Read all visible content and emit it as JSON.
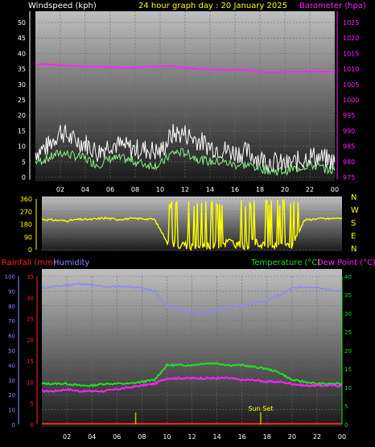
{
  "header": {
    "left_title": "Windspeed (kph)",
    "center_title": "24 hour graph day : 20 January 2025",
    "right_title": "Barometer (hpa)"
  },
  "bottom_header": {
    "rainfall": "Rainfall (mm)",
    "humidity": "Humidity",
    "temperature": "Temperature (°C)",
    "dewpoint": "Dew Point (°C)"
  },
  "annotation": {
    "sunset": "Sun Set"
  },
  "colors": {
    "wind": "#ffffff",
    "wind_avg": "#88ee88",
    "barometer": "#ff22ff",
    "direction": "#ffff00",
    "humidity": "#8888ff",
    "rain": "#ff2222",
    "temperature": "#22dd22",
    "dewpoint": "#ff22ff",
    "event": "#bbbb00"
  },
  "chart_data": [
    {
      "type": "line",
      "xlabel_ticks": [
        "02",
        "04",
        "06",
        "08",
        "10",
        "12",
        "14",
        "16",
        "18",
        "20",
        "22",
        "00"
      ],
      "left_axis": {
        "label": "Windspeed (kph)",
        "ylim": [
          0,
          50
        ],
        "ticks": [
          "0",
          "5",
          "10",
          "15",
          "20",
          "25",
          "30",
          "35",
          "40",
          "45",
          "50"
        ]
      },
      "right_axis": {
        "label": "Barometer (hpa)",
        "ylim": [
          975,
          1025
        ],
        "ticks": [
          "975",
          "980",
          "985",
          "990",
          "995",
          "1000",
          "1005",
          "1010",
          "1015",
          "1020",
          "1025"
        ]
      },
      "series": [
        {
          "axis": "right",
          "x": [
            0,
            1,
            2,
            3,
            4,
            5,
            6,
            7,
            8,
            9,
            10,
            11,
            12,
            13,
            14,
            15,
            16,
            17,
            18,
            19,
            20,
            21,
            22,
            23,
            24
          ],
          "values": [
            1011.5,
            1011.5,
            1011.2,
            1011.0,
            1010.8,
            1010.8,
            1010.7,
            1010.5,
            1010.5,
            1010.8,
            1010.8,
            1011.0,
            1010.5,
            1010.0,
            1009.8,
            1009.7,
            1009.8,
            1009.6,
            1009.0,
            1008.8,
            1009.0,
            1009.0,
            1009.2,
            1009.2,
            1009.0
          ]
        },
        {
          "x": [
            0,
            1,
            2,
            3,
            4,
            5,
            6,
            7,
            8,
            9,
            10,
            11,
            12,
            13,
            14,
            15,
            16,
            17,
            18,
            19,
            20,
            21,
            22,
            23,
            24
          ],
          "values": [
            8,
            10,
            15,
            12,
            11,
            8,
            11,
            10,
            9,
            9,
            8,
            14,
            14,
            12,
            10,
            9,
            8,
            8,
            6,
            5,
            4,
            5,
            7,
            6,
            5
          ]
        },
        {
          "x": [
            0,
            1,
            2,
            3,
            4,
            5,
            6,
            7,
            8,
            9,
            10,
            11,
            12,
            13,
            14,
            15,
            16,
            17,
            18,
            19,
            20,
            21,
            22,
            23,
            24
          ],
          "values": [
            5,
            6,
            8,
            7,
            6,
            4,
            6,
            6,
            5,
            4,
            4,
            8,
            8,
            6,
            5,
            5,
            4,
            4,
            3,
            2,
            2,
            3,
            4,
            3,
            2
          ]
        }
      ]
    },
    {
      "type": "scatter",
      "ylim": [
        0,
        360
      ],
      "ticks": [
        "0",
        "90",
        "180",
        "270",
        "360"
      ],
      "compass": [
        "N",
        "W",
        "S",
        "E",
        "N"
      ],
      "x": [
        0,
        1,
        2,
        3,
        4,
        5,
        6,
        7,
        8,
        9,
        10,
        11,
        12,
        13,
        14,
        15,
        16,
        17,
        18,
        19,
        20,
        21,
        22,
        23,
        24
      ],
      "values": [
        215,
        210,
        205,
        215,
        215,
        225,
        215,
        220,
        220,
        215,
        60,
        30,
        25,
        30,
        35,
        60,
        25,
        50,
        40,
        30,
        30,
        210,
        220,
        220,
        225
      ]
    },
    {
      "type": "line",
      "xlabel_ticks": [
        "02",
        "04",
        "06",
        "08",
        "10",
        "12",
        "14",
        "16",
        "18",
        "20",
        "22",
        "00"
      ],
      "humidity_axis": {
        "label": "Humidity",
        "ylim": [
          0,
          100
        ],
        "ticks": [
          "0",
          "10",
          "20",
          "30",
          "40",
          "50",
          "60",
          "70",
          "80",
          "90",
          "100"
        ]
      },
      "rain_axis": {
        "label": "Rainfall (mm)",
        "ylim": [
          0,
          35
        ],
        "ticks": [
          "0",
          "5",
          "10",
          "15",
          "20",
          "25",
          "30",
          "35"
        ]
      },
      "temp_axis": {
        "label": "Temperature (°C)",
        "ylim": [
          0,
          40
        ],
        "ticks": [
          "0",
          "5",
          "10",
          "15",
          "20",
          "25",
          "30",
          "35",
          "40"
        ]
      },
      "series": [
        {
          "axis": "humidity",
          "x": [
            0,
            1,
            2,
            3,
            4,
            5,
            6,
            7,
            8,
            9,
            10,
            11,
            12,
            13,
            14,
            15,
            16,
            17,
            18,
            19,
            20,
            21,
            22,
            23,
            24
          ],
          "values": [
            92,
            93,
            94,
            95,
            94,
            93,
            93,
            93,
            92,
            90,
            80,
            78,
            76,
            75,
            77,
            79,
            80,
            82,
            84,
            87,
            92,
            93,
            92,
            91,
            90
          ]
        },
        {
          "axis": "rain",
          "x": [
            0,
            24
          ],
          "values": [
            0,
            0
          ]
        },
        {
          "axis": "temp",
          "x": [
            0,
            1,
            2,
            3,
            4,
            5,
            6,
            7,
            8,
            9,
            10,
            11,
            12,
            13,
            14,
            15,
            16,
            17,
            18,
            19,
            20,
            21,
            22,
            23,
            24
          ],
          "values": [
            11,
            11,
            11,
            10.5,
            10.5,
            11,
            11,
            11,
            11.5,
            12,
            16,
            16,
            16,
            16.5,
            16.5,
            16,
            16,
            15.5,
            15,
            14,
            12,
            11.5,
            11,
            11,
            11
          ]
        },
        {
          "axis": "temp",
          "x": [
            0,
            1,
            2,
            3,
            4,
            5,
            6,
            7,
            8,
            9,
            10,
            11,
            12,
            13,
            14,
            15,
            16,
            17,
            18,
            19,
            20,
            21,
            22,
            23,
            24
          ],
          "values": [
            9,
            9,
            9.5,
            9,
            9,
            9,
            9.5,
            10,
            10.5,
            11,
            12.5,
            12.5,
            12.5,
            12.5,
            12.5,
            12.5,
            12,
            12,
            11.5,
            11.5,
            11,
            10.5,
            10.5,
            10.5,
            10.5
          ]
        }
      ],
      "events": [
        7.5,
        17.5
      ]
    }
  ]
}
